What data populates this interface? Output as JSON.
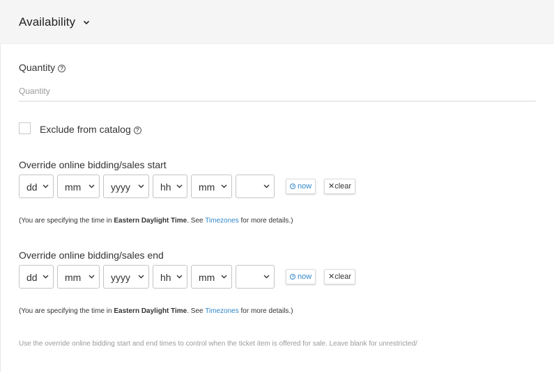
{
  "header": {
    "title": "Availability",
    "icon": "chevron-down-icon"
  },
  "quantity": {
    "label": "Quantity",
    "placeholder": "Quantity",
    "value": ""
  },
  "exclude": {
    "label": "Exclude from catalog",
    "checked": false
  },
  "start": {
    "label": "Override online bidding/sales start",
    "selects": {
      "day": "dd",
      "month": "mm",
      "year": "yyyy",
      "hour": "hh",
      "minute": "mm",
      "ampm": ""
    },
    "now_label": "now",
    "clear_label": "clear",
    "tz": {
      "prefix": "(You are specifying the time in ",
      "zone": "Eastern Daylight Time",
      "mid": ". See ",
      "link": "Timezones",
      "suffix": " for more details.)"
    }
  },
  "end": {
    "label": "Override online bidding/sales end",
    "selects": {
      "day": "dd",
      "month": "mm",
      "year": "yyyy",
      "hour": "hh",
      "minute": "mm",
      "ampm": ""
    },
    "now_label": "now",
    "clear_label": "clear",
    "tz": {
      "prefix": "(You are specifying the time in ",
      "zone": "Eastern Daylight Time",
      "mid": ". See ",
      "link": "Timezones",
      "suffix": " for more details.)"
    }
  },
  "hint": "Use the override online bidding start and end times to control when the ticket item is offered for sale. Leave blank for unrestricted/",
  "colors": {
    "link": "#2f86c8",
    "header_bg": "#f5f5f5",
    "muted": "#9a9a9a"
  }
}
